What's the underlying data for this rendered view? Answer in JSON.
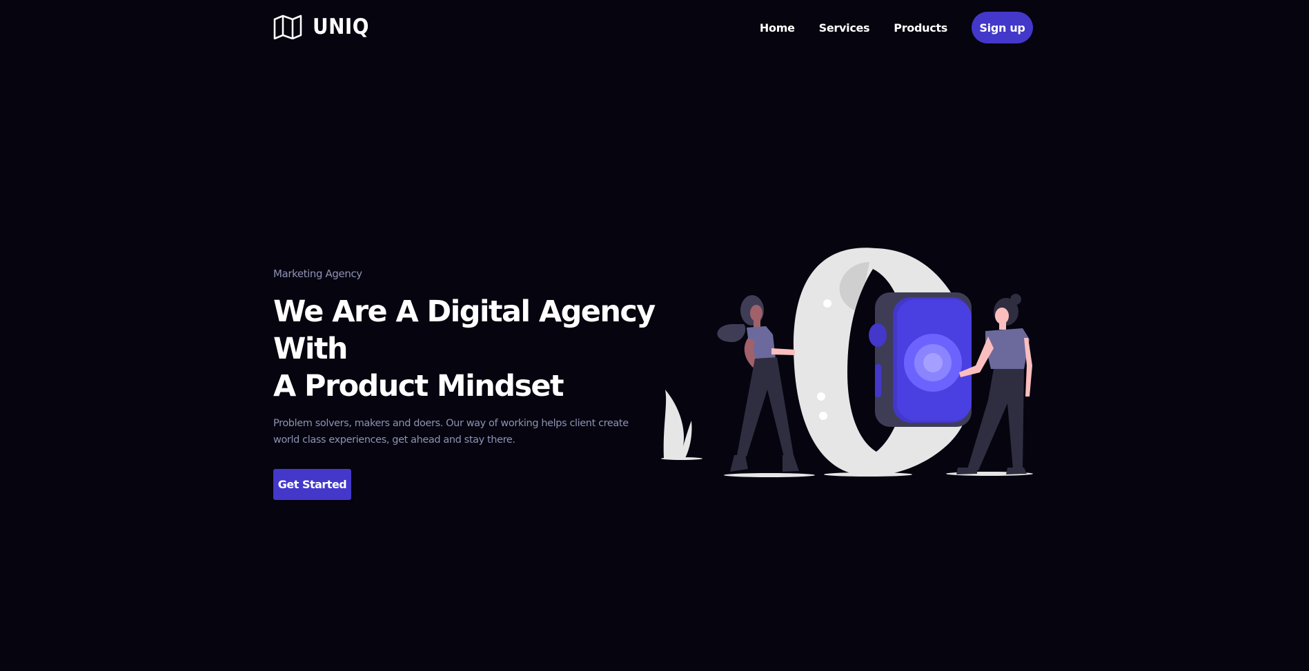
{
  "brand": {
    "name": "UNIQ",
    "logo_icon": "map-icon"
  },
  "nav": {
    "links": [
      "Home",
      "Services",
      "Products"
    ],
    "signup_label": "Sign up"
  },
  "hero": {
    "eyebrow": "Marketing Agency",
    "headline_line1": "We Are A Digital Agency With",
    "headline_line2": "A Product Mindset",
    "description": "Problem solvers, makers and doers. Our way of working helps client create world class experiences, get ahead and stay there.",
    "cta_label": "Get Started"
  },
  "colors": {
    "background": "#05040f",
    "accent": "#4338ca",
    "muted_text": "#8e93b4",
    "text": "#ffffff"
  },
  "illustration": {
    "subject": "two people beside a giant smartwatch"
  }
}
